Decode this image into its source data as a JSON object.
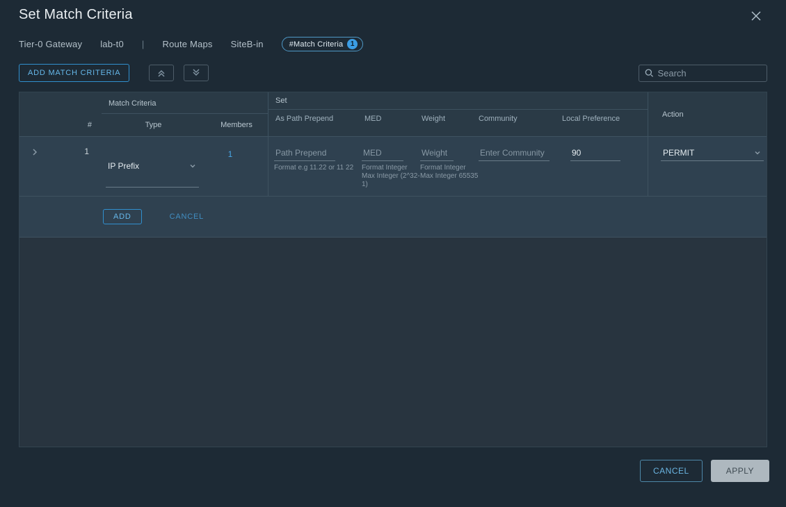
{
  "header": {
    "title": "Set Match Criteria"
  },
  "breadcrumb": {
    "items": [
      "Tier-0 Gateway",
      "lab-t0"
    ],
    "sep": "|",
    "items2": [
      "Route Maps",
      "SiteB-in"
    ],
    "chip_label": "#Match Criteria",
    "chip_count": "1"
  },
  "toolbar": {
    "add_label": "ADD MATCH CRITERIA",
    "search_placeholder": "Search"
  },
  "columns": {
    "idx": "#",
    "match": "Match Criteria",
    "match_type": "Type",
    "match_members": "Members",
    "set": "Set",
    "set_path": "As Path Prepend",
    "set_med": "MED",
    "set_weight": "Weight",
    "set_comm": "Community",
    "set_lpref": "Local Preference",
    "action": "Action"
  },
  "row": {
    "index": "1",
    "type_value": "IP Prefix",
    "members_link": "1",
    "path_placeholder": "Path Prepend",
    "path_hint": "Format e.g 11.22 or 11 22",
    "med_placeholder": "MED",
    "med_hint": "Format Integer Max Integer (2^32-1)",
    "weight_placeholder": "Weight",
    "weight_hint": "Format Integer Max Integer 65535",
    "comm_placeholder": "Enter Community",
    "lpref_value": "90",
    "action_value": "PERMIT"
  },
  "row_actions": {
    "add": "ADD",
    "cancel": "CANCEL"
  },
  "footer": {
    "cancel": "CANCEL",
    "apply": "APPLY"
  }
}
